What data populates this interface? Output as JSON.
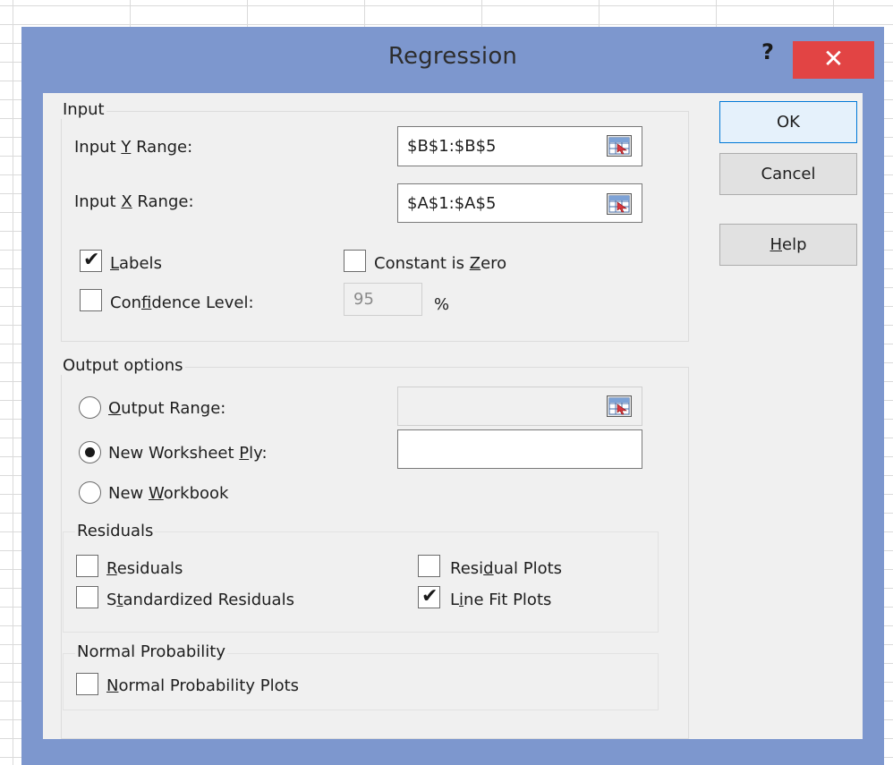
{
  "dialog": {
    "title": "Regression",
    "help_glyph": "?",
    "close_glyph": "✕"
  },
  "input": {
    "group_label": "Input",
    "y_range": {
      "label_pre": "Input ",
      "label_key": "Y",
      "label_post": " Range:",
      "value": "$B$1:$B$5"
    },
    "x_range": {
      "label_pre": "Input ",
      "label_key": "X",
      "label_post": " Range:",
      "value": "$A$1:$A$5"
    },
    "labels": {
      "label_key": "L",
      "label_post": "abels",
      "checked": true
    },
    "constant_zero": {
      "label_pre": "Constant is ",
      "label_key": "Z",
      "label_post": "ero",
      "checked": false
    },
    "confidence": {
      "label_pre": "Con",
      "label_key": "f",
      "label_post": "idence Level:",
      "value": "95",
      "unit": "%",
      "checked": false
    }
  },
  "output": {
    "group_label": "Output options",
    "output_range": {
      "label_key": "O",
      "label_post": "utput Range:",
      "selected": false
    },
    "new_worksheet": {
      "label_pre": "New Worksheet ",
      "label_key": "P",
      "label_post": "ly:",
      "selected": true
    },
    "new_workbook": {
      "label_pre": "New ",
      "label_key": "W",
      "label_post": "orkbook",
      "selected": false
    }
  },
  "residuals": {
    "group_label": "Residuals",
    "residuals": {
      "label_key": "R",
      "label_post": "esiduals",
      "checked": false
    },
    "standardized": {
      "label_pre": "S",
      "label_key": "t",
      "label_post": "andardized Residuals",
      "checked": false
    },
    "residual_plots": {
      "label_pre": "Resi",
      "label_key": "d",
      "label_post": "ual Plots",
      "checked": false
    },
    "line_fit_plots": {
      "label_pre": "L",
      "label_key": "i",
      "label_post": "ne Fit Plots",
      "checked": true
    },
    "check_glyph": "✔"
  },
  "normal_probability": {
    "group_label": "Normal Probability",
    "plots": {
      "label_key": "N",
      "label_post": "ormal Probability Plots",
      "checked": false
    }
  },
  "buttons": {
    "ok": "OK",
    "cancel": "Cancel",
    "help_key": "H",
    "help_post": "elp"
  },
  "colors": {
    "dialog_frame": "#7d97ce",
    "client_bg": "#f0f0f0",
    "close_button": "#e24444",
    "default_button_border": "#0078d7"
  },
  "icons": [
    "help-icon",
    "close-icon",
    "range-select-icon",
    "check-icon"
  ]
}
